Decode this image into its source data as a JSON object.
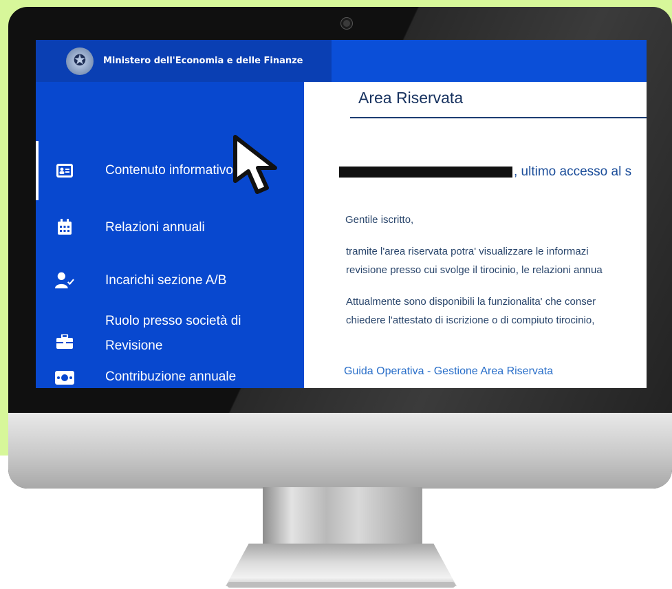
{
  "header": {
    "ministry_name": "Ministero dell'Economia e delle Finanze"
  },
  "sidebar": {
    "items": [
      {
        "label": "Contenuto informativo",
        "icon": "id-card-icon",
        "active": true
      },
      {
        "label": "Relazioni annuali",
        "icon": "calendar-icon",
        "active": false
      },
      {
        "label": "Incarichi sezione A/B",
        "icon": "user-check-icon",
        "active": false
      },
      {
        "label_line1": "Ruolo presso società di",
        "label_line2": "Revisione",
        "icon": "briefcase-icon",
        "active": false
      },
      {
        "label": "Contribuzione annuale",
        "icon": "money-icon",
        "active": false
      }
    ]
  },
  "main": {
    "title": "Area Riservata",
    "greeting_suffix": ", ultimo accesso al s",
    "salutation": "Gentile iscritto,",
    "paragraph1_line1": "tramite l'area riservata potra' visualizzare le informazi",
    "paragraph1_line2": "revisione presso cui svolge il tirocinio, le relazioni annua",
    "paragraph2_line1": "Attualmente sono disponibili la funzionalita' che conser",
    "paragraph2_line2": "chiedere l'attestato di iscrizione o di compiuto tirocinio, ",
    "guide_link": "Guida Operativa - Gestione Area Riservata"
  },
  "colors": {
    "background_green": "#d7f79a",
    "topbar_blue": "#0b4fd8",
    "sidebar_blue": "#0848cf",
    "title_navy": "#17325f",
    "link_blue": "#2a6fc9"
  }
}
